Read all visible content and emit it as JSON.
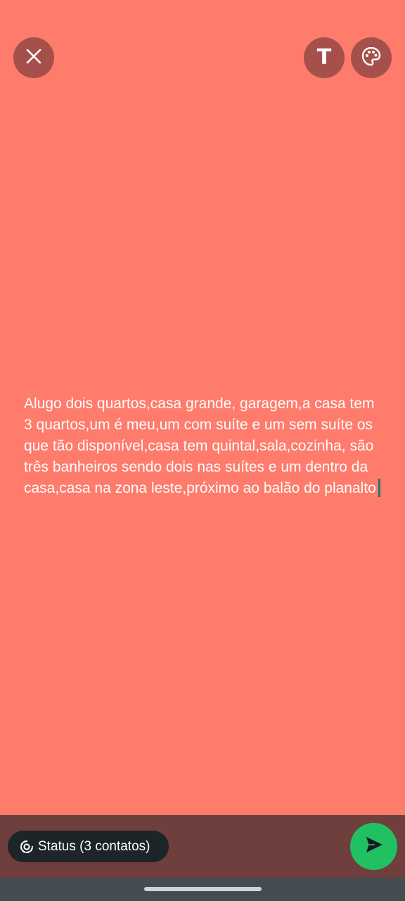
{
  "colors": {
    "background": "#ff7b6b",
    "top_button_bg": "#a5504a",
    "bottom_bar": "#6f3f3d",
    "pill_bg": "#1e2529",
    "send_button": "#21c063",
    "caret": "#1f7a6a",
    "nav_bar": "#454c51"
  },
  "toolbar": {
    "close_icon": "close-icon",
    "text_button_glyph": "T",
    "palette_icon": "palette-icon"
  },
  "status": {
    "text": "Alugo dois quartos,casa grande, garagem,a casa tem 3 quartos,um é meu,um com suíte e um sem suíte os que tão disponível,casa tem quintal,sala,cozinha, são três banheiros sendo dois nas suítes e um dentro da casa,casa na zona leste,próximo ao balão do planalto"
  },
  "footer": {
    "audience_label": "Status (3 contatos)",
    "audience_icon": "status-icon",
    "send_icon": "send-icon"
  }
}
